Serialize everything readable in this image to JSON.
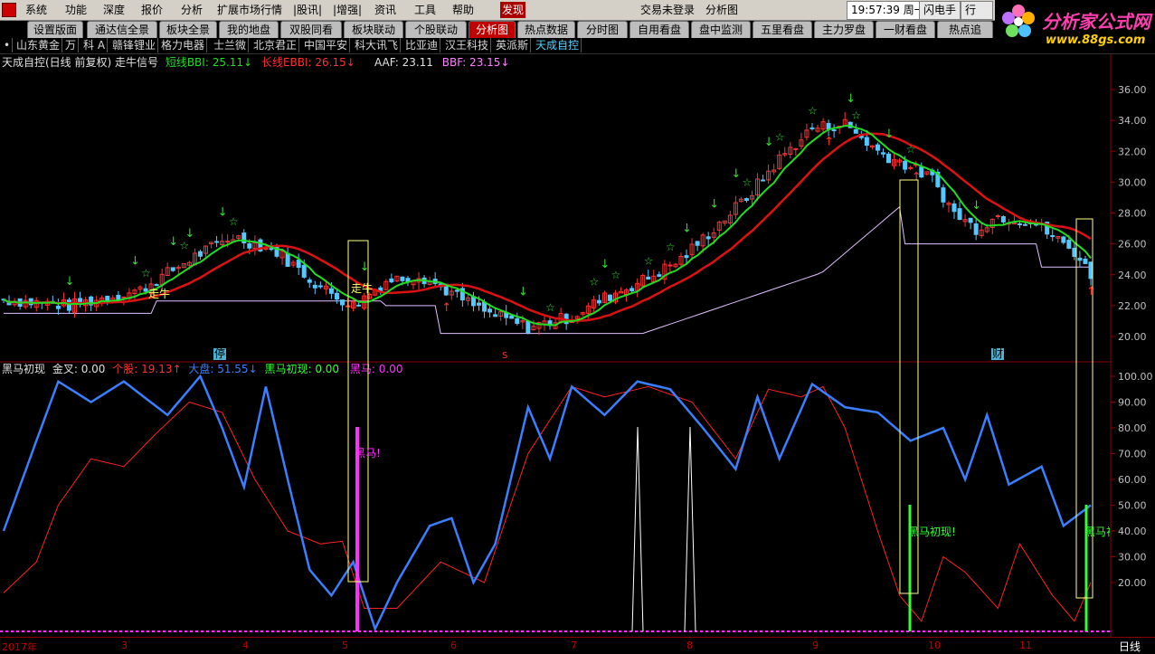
{
  "menubar": {
    "items": [
      "系统",
      "功能",
      "深度",
      "报价",
      "分析",
      "扩展市场行情",
      "|股讯|",
      "|增强|",
      "资讯",
      "工具",
      "帮助",
      "发现"
    ],
    "highlight_item": "发现",
    "center_status": "交易未登录",
    "center_view": "分析图",
    "clock": "19:57:39 周一",
    "flash_button": "闪电手",
    "extra_button": "行"
  },
  "brand": {
    "title": "分析家公式网",
    "url": "www.88gs.com"
  },
  "tabs": [
    "设置版面",
    "通达信全景",
    "板块全景",
    "我的地盘",
    "双股同看",
    "板块联动",
    "个股联动",
    "分析图",
    "热点数据",
    "分时图",
    "自用看盘",
    "盘中监测",
    "五里看盘",
    "主力罗盘",
    "一财看盘",
    "热点追"
  ],
  "active_tab": "分析图",
  "stocks": [
    "•",
    "山东黄金",
    "万",
    "科 A",
    "赣锋锂业",
    "格力电器",
    "士兰微",
    "北京君正",
    "中国平安",
    "科大讯飞",
    "比亚迪",
    "汉王科技",
    "英派斯",
    "天成自控"
  ],
  "active_stock": "天成自控",
  "main_chart": {
    "title": "天成自控(日线 前复权) 走牛信号",
    "short_label": "短线BBI: 25.11",
    "long_label": "长线EBBI: 26.15",
    "aaf_label": "AAF: 23.11",
    "bbf_label": "BBF: 23.15",
    "y_ticks": [
      "36.00",
      "34.00",
      "32.00",
      "30.00",
      "28.00",
      "26.00",
      "24.00",
      "22.00",
      "20.00"
    ],
    "annotations": {
      "zou_niu_1": "走牛",
      "zou_niu_2": "走牛",
      "ting": "停",
      "cai": "财",
      "mark_s": "S"
    },
    "colors": {
      "up": "#ff3030",
      "down": "#54c8ff",
      "short_line": "#22dd22",
      "long_line": "#dd1111",
      "aux_line": "#ffffff"
    }
  },
  "indicator": {
    "name": "黑马初现",
    "jincha_label": "金叉: 0.00",
    "gegu_label": "个股: 19.13",
    "dapan_label": "大盘: 51.55",
    "heima_chuxian_label": "黑马初现: 0.00",
    "heima_label": "黑马: 0.00",
    "y_ticks": [
      "100.00",
      "90.00",
      "80.00",
      "70.00",
      "60.00",
      "50.00",
      "40.00",
      "30.00",
      "20.00"
    ],
    "text_heima": "黑马!",
    "text_chuxian_1": "黑马初现!",
    "text_chuxian_2": "黑马初",
    "colors": {
      "gegu": "#ff2020",
      "dapan": "#3a7fff",
      "heima": "#ff30ff",
      "chuxian": "#30ff30"
    }
  },
  "x_axis": {
    "labels": [
      "2017年",
      "3",
      "4",
      "5",
      "6",
      "7",
      "8",
      "9",
      "10",
      "11"
    ],
    "period": "日线"
  }
}
